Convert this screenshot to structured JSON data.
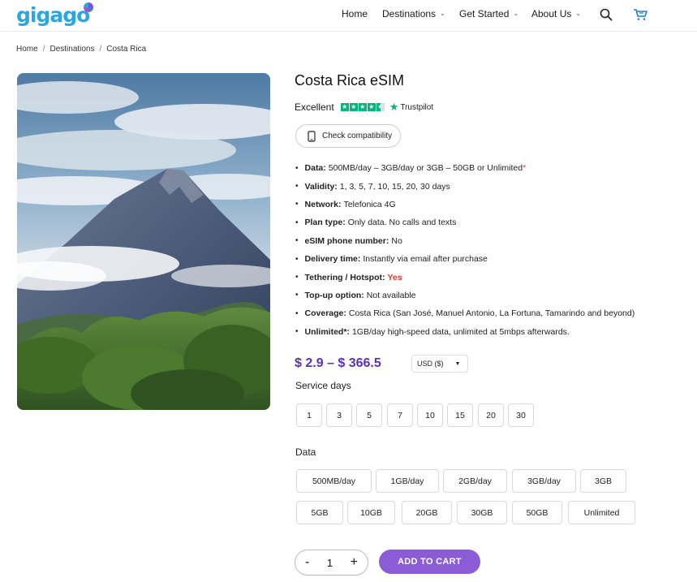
{
  "header": {
    "logo": "gigago",
    "nav": [
      "Home",
      "Destinations",
      "Get Started",
      "About Us"
    ]
  },
  "icons": {
    "search": "search-icon",
    "cart": "cart-icon",
    "phone": "phone-icon",
    "chevron": "chevron-down-icon"
  },
  "breadcrumb": [
    "Home",
    "Destinations",
    "Costa Rica"
  ],
  "product": {
    "title": "Costa Rica eSIM",
    "rating_label": "Excellent",
    "rating_stars": 4.5,
    "trustpilot": "Trustpilot",
    "compat_button": "Check compatibility",
    "specs": [
      {
        "k": "Data:",
        "v": "500MB/day – 3GB/day or 3GB – 50GB or Unlimited",
        "mark": "*"
      },
      {
        "k": "Validity:",
        "v": "1, 3, 5, 7, 10, 15, 20, 30 days"
      },
      {
        "k": "Network:",
        "v": "Telefonica 4G"
      },
      {
        "k": "Plan type:",
        "v": "Only data. No calls and texts"
      },
      {
        "k": "eSIM phone number:",
        "v": "No"
      },
      {
        "k": "Delivery time:",
        "v": "Instantly via email after purchase"
      },
      {
        "k": "Tethering / Hotspot:",
        "v": "Yes"
      },
      {
        "k": "Top-up option:",
        "v": "Not available"
      },
      {
        "k": "Coverage:",
        "v": "Costa Rica (San José, Manuel Antonio, La Fortuna, Tamarindo and beyond)"
      },
      {
        "k": "Unlimited*:",
        "v": "1GB/day high-speed data, unlimited at 5mbps afterwards."
      }
    ],
    "price": "$ 2.9 – $ 366.5",
    "currency": "USD ($)",
    "service_days_label": "Service days",
    "service_days": [
      "1",
      "3",
      "5",
      "7",
      "10",
      "15",
      "20",
      "30"
    ],
    "data_label": "Data",
    "data_options_row1": [
      "500MB/day",
      "1GB/day",
      "2GB/day",
      "3GB/day",
      "3GB"
    ],
    "data_options_row2": [
      "5GB",
      "10GB",
      "20GB",
      "30GB",
      "50GB",
      "Unlimited"
    ],
    "quantity": "1",
    "qty_minus": "-",
    "qty_plus": "+",
    "add_to_cart": "ADD TO CART"
  },
  "colors": {
    "accent": "#8a5cd6",
    "price": "#5a2fc2",
    "trustpilot": "#00b67a",
    "highlight": "#e33333",
    "logo": "#2aa6e0"
  }
}
